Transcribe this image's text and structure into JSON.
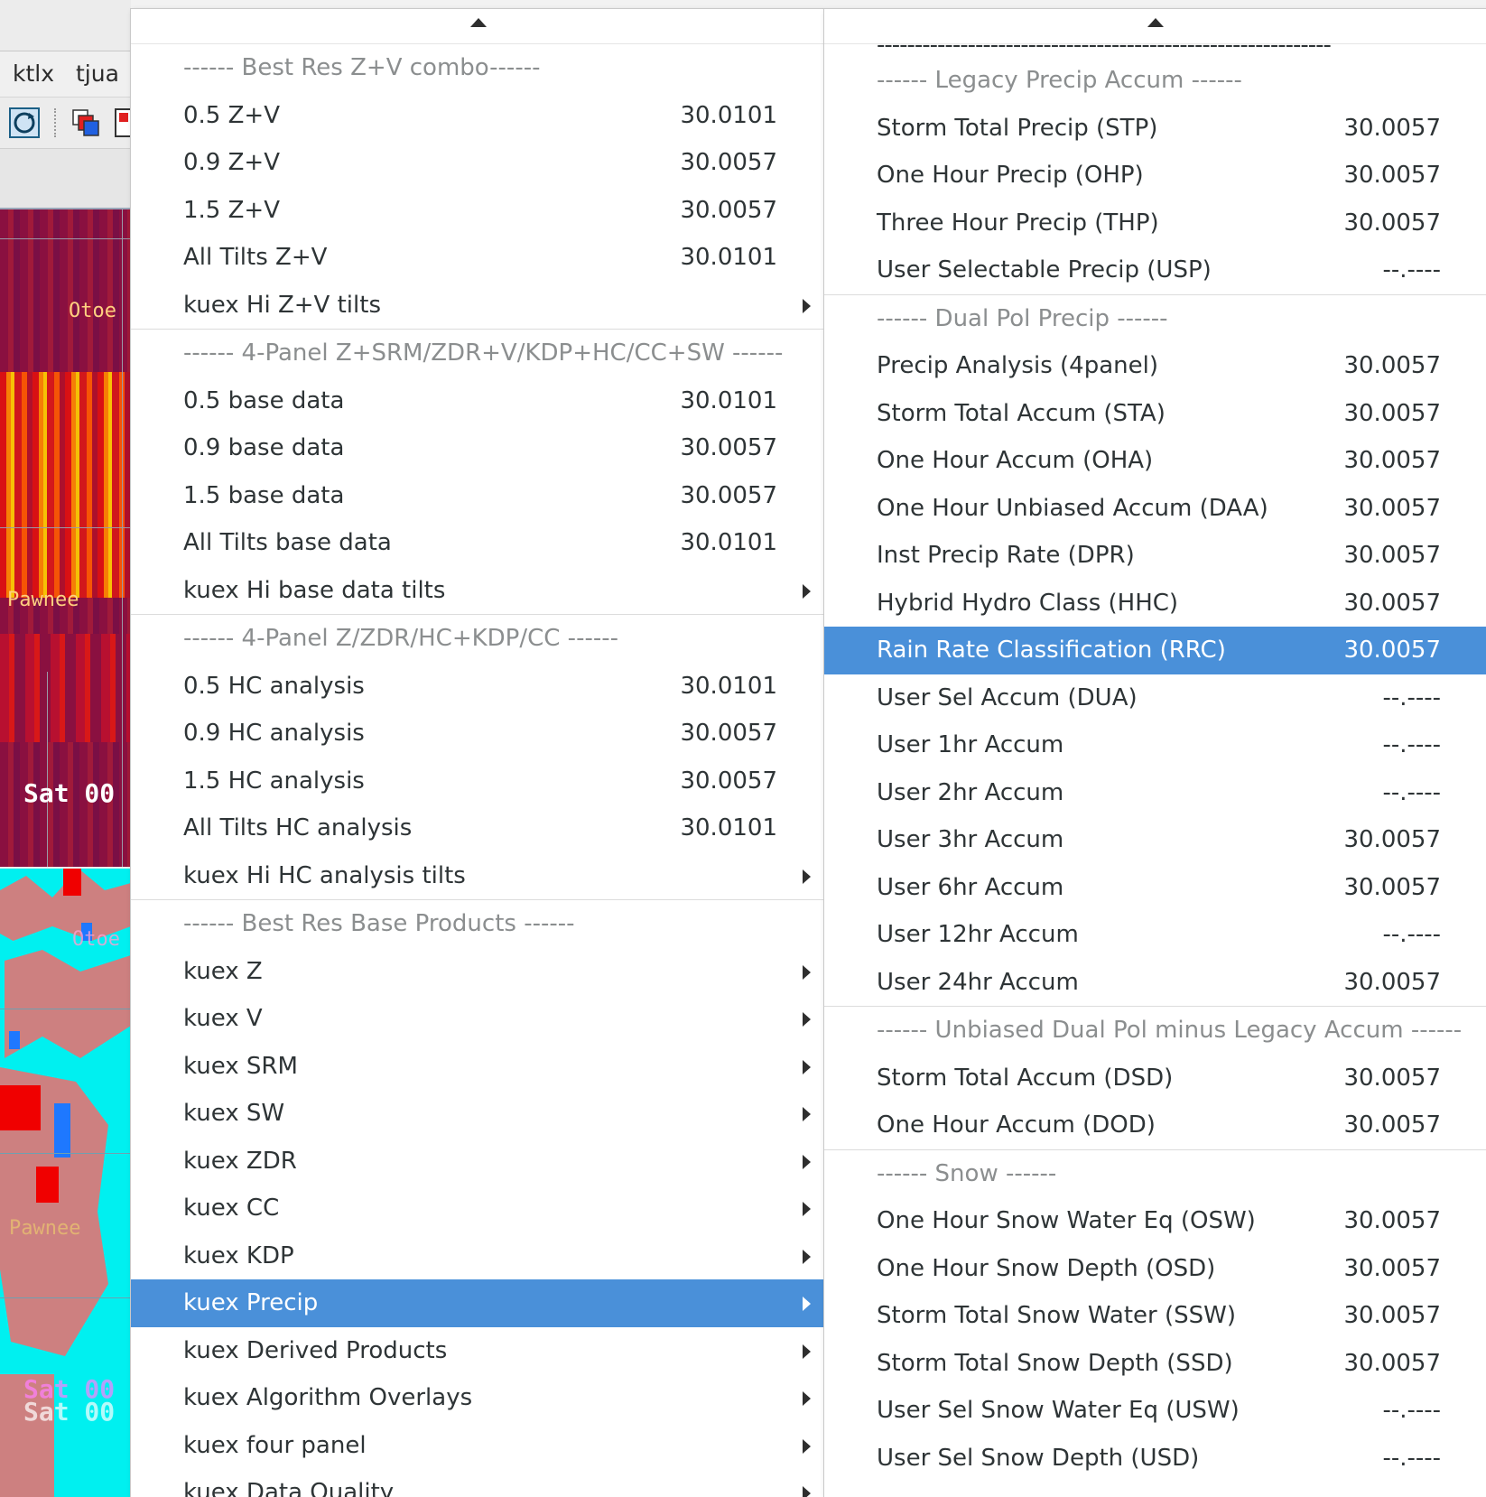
{
  "background_window": {
    "menubar": [
      "ktlx",
      "tjua"
    ],
    "map_labels": {
      "upper_1": "Otoe",
      "upper_2": "Pawnee",
      "lower_1": "Otoe",
      "lower_2": "Pawnee"
    },
    "time_stamp_upper": "Sat 00",
    "time_stamp_lower_1": "Sat 00",
    "time_stamp_lower_2": "Sat 00",
    "colors": {
      "radar_base": "#8a1040",
      "velocity_bg": "#00f0f0"
    }
  },
  "left_menu": {
    "groups": [
      {
        "header": "------ Best Res Z+V combo------",
        "items": [
          {
            "label": "0.5 Z+V",
            "value": "30.0101"
          },
          {
            "label": "0.9 Z+V",
            "value": "30.0057"
          },
          {
            "label": "1.5 Z+V",
            "value": "30.0057"
          },
          {
            "label": "All Tilts Z+V",
            "value": "30.0101"
          },
          {
            "label": "kuex Hi Z+V tilts",
            "submenu": true
          }
        ]
      },
      {
        "header": "------ 4-Panel Z+SRM/ZDR+V/KDP+HC/CC+SW ------",
        "items": [
          {
            "label": "0.5 base data",
            "value": "30.0101"
          },
          {
            "label": "0.9 base data",
            "value": "30.0057"
          },
          {
            "label": "1.5 base data",
            "value": "30.0057"
          },
          {
            "label": "All Tilts base data",
            "value": "30.0101"
          },
          {
            "label": "kuex Hi base data tilts",
            "submenu": true
          }
        ]
      },
      {
        "header": "------ 4-Panel Z/ZDR/HC+KDP/CC ------",
        "items": [
          {
            "label": "0.5 HC analysis",
            "value": "30.0101"
          },
          {
            "label": "0.9 HC analysis",
            "value": "30.0057"
          },
          {
            "label": "1.5 HC analysis",
            "value": "30.0057"
          },
          {
            "label": "All Tilts HC analysis",
            "value": "30.0101"
          },
          {
            "label": "kuex Hi HC analysis tilts",
            "submenu": true
          }
        ]
      },
      {
        "header": "------ Best Res Base Products ------",
        "items": [
          {
            "label": "kuex Z",
            "submenu": true
          },
          {
            "label": "kuex V",
            "submenu": true
          },
          {
            "label": "kuex SRM",
            "submenu": true
          },
          {
            "label": "kuex SW",
            "submenu": true
          },
          {
            "label": "kuex ZDR",
            "submenu": true
          },
          {
            "label": "kuex CC",
            "submenu": true
          },
          {
            "label": "kuex KDP",
            "submenu": true
          },
          {
            "label": "kuex Precip",
            "submenu": true,
            "selected": true
          },
          {
            "label": "kuex Derived Products",
            "submenu": true
          },
          {
            "label": "kuex Algorithm Overlays",
            "submenu": true
          },
          {
            "label": "kuex four panel",
            "submenu": true
          },
          {
            "label": "kuex Data Quality",
            "submenu": true
          }
        ]
      }
    ]
  },
  "right_menu": {
    "top_dashes": "------------------------------------------------------------",
    "groups": [
      {
        "header": "------ Legacy Precip Accum ------",
        "items": [
          {
            "label": "Storm Total Precip (STP)",
            "value": "30.0057"
          },
          {
            "label": "One Hour Precip (OHP)",
            "value": "30.0057"
          },
          {
            "label": "Three Hour Precip (THP)",
            "value": "30.0057"
          },
          {
            "label": "User Selectable Precip (USP)",
            "value": "--.----"
          }
        ]
      },
      {
        "header": "------ Dual Pol Precip ------",
        "items": [
          {
            "label": "Precip Analysis (4panel)",
            "value": "30.0057"
          },
          {
            "label": "Storm Total Accum (STA)",
            "value": "30.0057"
          },
          {
            "label": "One Hour Accum (OHA)",
            "value": "30.0057"
          },
          {
            "label": "One Hour Unbiased Accum (DAA)",
            "value": "30.0057"
          },
          {
            "label": "Inst Precip Rate (DPR)",
            "value": "30.0057"
          },
          {
            "label": "Hybrid Hydro Class (HHC)",
            "value": "30.0057"
          },
          {
            "label": "Rain Rate Classification (RRC)",
            "value": "30.0057",
            "selected": true
          },
          {
            "label": "User Sel Accum (DUA)",
            "value": "--.----"
          },
          {
            "label": "User 1hr Accum",
            "value": "--.----"
          },
          {
            "label": "User 2hr Accum",
            "value": "--.----"
          },
          {
            "label": "User 3hr Accum",
            "value": "30.0057"
          },
          {
            "label": "User 6hr Accum",
            "value": "30.0057"
          },
          {
            "label": "User 12hr Accum",
            "value": "--.----"
          },
          {
            "label": "User 24hr Accum",
            "value": "30.0057"
          }
        ]
      },
      {
        "header": "------ Unbiased Dual Pol minus Legacy Accum ------",
        "items": [
          {
            "label": "Storm Total Accum (DSD)",
            "value": "30.0057"
          },
          {
            "label": "One Hour Accum (DOD)",
            "value": "30.0057"
          }
        ]
      },
      {
        "header": "------ Snow ------",
        "items": [
          {
            "label": "One Hour Snow Water Eq (OSW)",
            "value": "30.0057"
          },
          {
            "label": "One Hour Snow Depth (OSD)",
            "value": "30.0057"
          },
          {
            "label": "Storm Total Snow Water (SSW)",
            "value": "30.0057"
          },
          {
            "label": "Storm Total Snow Depth (SSD)",
            "value": "30.0057"
          },
          {
            "label": "User Sel Snow Water Eq (USW)",
            "value": "--.----"
          },
          {
            "label": "User Sel Snow Depth (USD)",
            "value": "--.----"
          }
        ]
      }
    ]
  },
  "colors": {
    "selection": "#4a90d9",
    "header_text": "#8b8e8f",
    "item_text": "#2e3436"
  }
}
